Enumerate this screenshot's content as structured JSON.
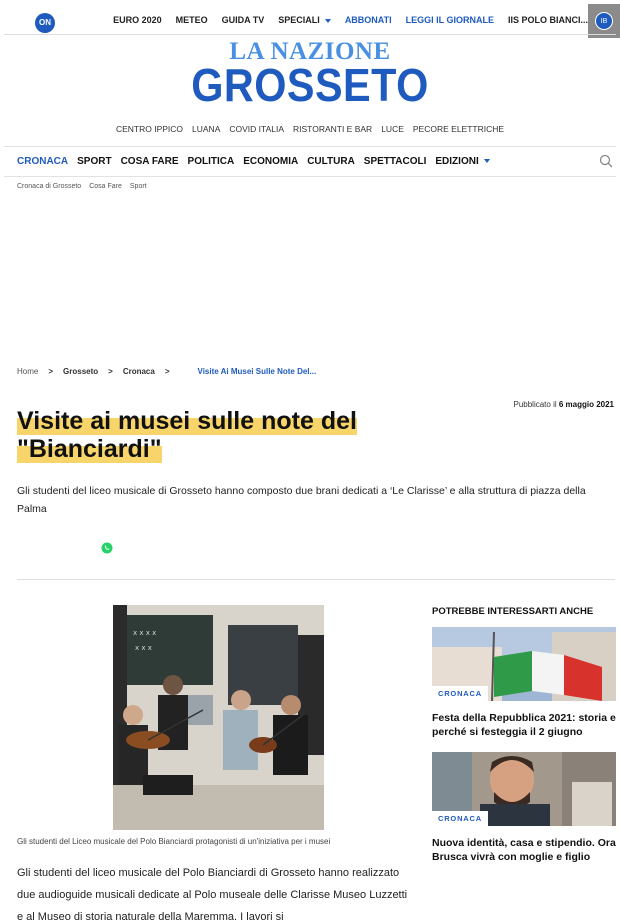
{
  "top": {
    "logo": "ON",
    "nav": [
      {
        "label": "EURO 2020"
      },
      {
        "label": "METEO"
      },
      {
        "label": "GUIDA TV"
      },
      {
        "label": "SPECIALI"
      },
      {
        "label": "ABBONATI"
      },
      {
        "label": "LEGGI IL GIORNALE"
      },
      {
        "label": "IIS POLO BIANCI..."
      }
    ],
    "avatar": "IB"
  },
  "masthead": {
    "line1": "LA NAZIONE",
    "line2": "GROSSETO"
  },
  "tags": [
    "CENTRO IPPICO",
    "LUANA",
    "COVID ITALIA",
    "RISTORANTI E BAR",
    "LUCE",
    "PECORE ELETTRICHE"
  ],
  "main_nav": [
    "CRONACA",
    "SPORT",
    "COSA FARE",
    "POLITICA",
    "ECONOMIA",
    "CULTURA",
    "SPETTACOLI",
    "EDIZIONI"
  ],
  "sub_nav": [
    "Cronaca di Grosseto",
    "Cosa Fare",
    "Sport"
  ],
  "breadcrumb": {
    "items": [
      "Home",
      "Grosseto",
      "Cronaca"
    ],
    "separator": ">",
    "current": "Visite Ai Musei Sulle Note Del..."
  },
  "article": {
    "published_label": "Pubblicato il",
    "published_date": "6 maggio 2021",
    "title": "Visite ai musei sulle note del \"Bianciardi\"",
    "subtitle": "Gli studenti del liceo musicale di Grosseto hanno composto due brani dedicati a ‘Le Clarisse’ e alla struttura di piazza della Palma",
    "caption": "Gli studenti del Liceo musicale del Polo Bianciardi protagonisti di un'iniziativa per i musei",
    "body": "Gli studenti del liceo musicale del Polo Bianciardi di Grosseto hanno realizzato due audioguide musicali dedicate al Polo museale delle Clarisse Museo Luzzetti e al Museo di storia naturale della Maremma. I lavori si"
  },
  "sidebar": {
    "heading": "POTREBBE INTERESSARTI ANCHE",
    "cards": [
      {
        "badge": "CRONACA",
        "title": "Festa della Repubblica 2021: storia e perché si festeggia il 2 giugno"
      },
      {
        "badge": "CRONACA",
        "title": "Nuova identità, casa e stipendio. Ora Brusca vivrà con moglie e figlio"
      }
    ]
  },
  "colors": {
    "brand_blue": "#1f5bbf",
    "light_blue": "#4a90e2",
    "highlight": "#f8d56a",
    "whatsapp": "#25d366"
  }
}
